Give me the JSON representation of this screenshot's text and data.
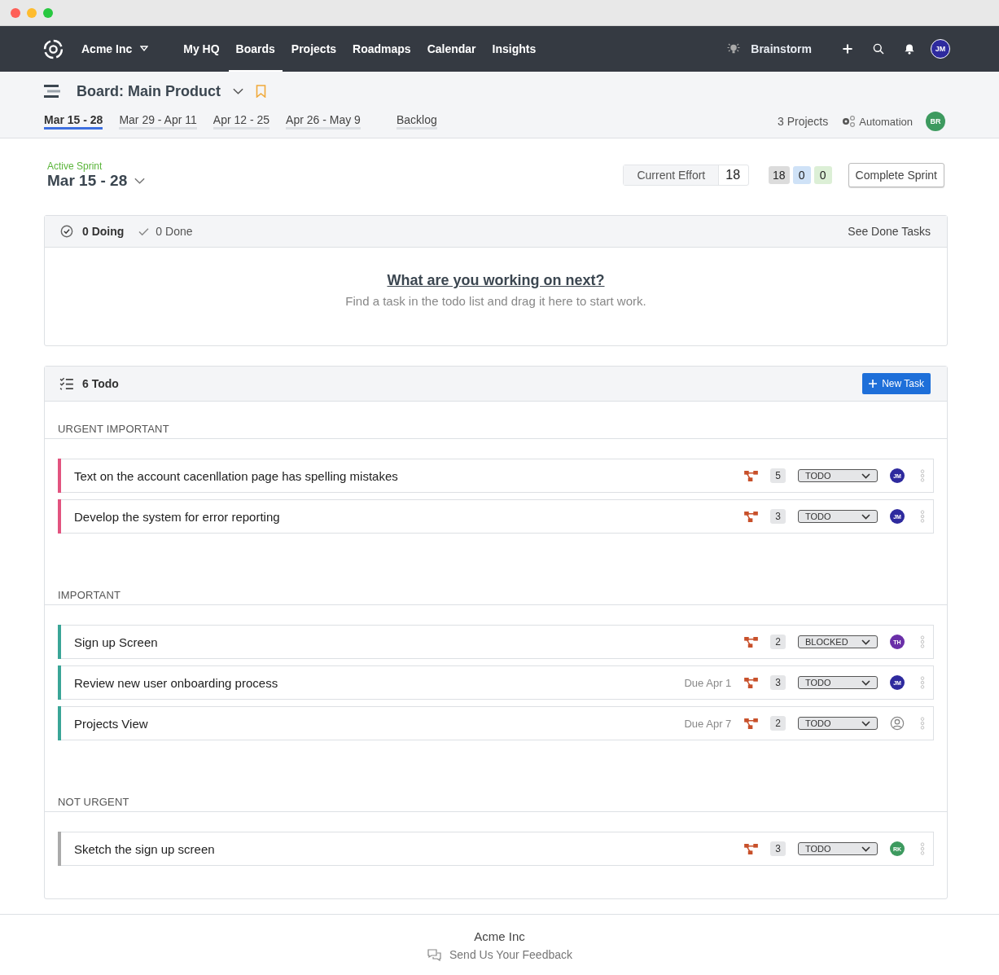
{
  "nav": {
    "org": "Acme Inc",
    "items": [
      {
        "label": "My HQ",
        "selected": false
      },
      {
        "label": "Boards",
        "selected": true
      },
      {
        "label": "Projects",
        "selected": false
      },
      {
        "label": "Roadmaps",
        "selected": false
      },
      {
        "label": "Calendar",
        "selected": false
      },
      {
        "label": "Insights",
        "selected": false
      }
    ],
    "brainstorm": "Brainstorm",
    "user": {
      "initials": "JM",
      "color": "#2e2a9e"
    }
  },
  "board": {
    "title": "Board: Main Product",
    "sprints": [
      {
        "label": "Mar 15 - 28",
        "selected": true
      },
      {
        "label": "Mar 29 - Apr 11",
        "selected": false
      },
      {
        "label": "Apr 12 - 25",
        "selected": false
      },
      {
        "label": "Apr 26 - May 9",
        "selected": false
      },
      {
        "label": "Backlog",
        "selected": false
      }
    ],
    "projects": "3 Projects",
    "automation": "Automation",
    "member": {
      "initials": "BR",
      "color": "#3d9a5f"
    }
  },
  "sprint": {
    "status": "Active Sprint",
    "range": "Mar 15 - 28",
    "effort_label": "Current Effort",
    "effort": "18",
    "counts": [
      {
        "value": "18",
        "color": "#dcdcdc"
      },
      {
        "value": "0",
        "color": "#cfe2f7"
      },
      {
        "value": "0",
        "color": "#dcefd6"
      }
    ],
    "complete": "Complete Sprint"
  },
  "doing": {
    "doing": "0 Doing",
    "done": "0 Done",
    "see_done": "See Done Tasks",
    "empty_title": "What are you working on next?",
    "empty_text": "Find a task in the todo list and drag it here to start work."
  },
  "todo": {
    "title": "6 Todo",
    "new_task": "New Task",
    "groups": [
      {
        "name": "URGENT IMPORTANT",
        "color": "#e2537f",
        "tasks": [
          {
            "title": "Text on the account cacenllation page has spelling mistakes",
            "effort": "5",
            "status": "TODO",
            "assignee": {
              "initials": "JM",
              "color": "#2e2a9e"
            }
          },
          {
            "title": "Develop the system for error reporting",
            "effort": "3",
            "status": "TODO",
            "assignee": {
              "initials": "JM",
              "color": "#2e2a9e"
            }
          }
        ]
      },
      {
        "name": "IMPORTANT",
        "color": "#3aa597",
        "tasks": [
          {
            "title": "Sign up Screen",
            "effort": "2",
            "status": "BLOCKED",
            "assignee": {
              "initials": "TH",
              "color": "#6a2fa8"
            }
          },
          {
            "title": "Review new user onboarding process",
            "due": "Due Apr 1",
            "effort": "3",
            "status": "TODO",
            "assignee": {
              "initials": "JM",
              "color": "#2e2a9e"
            }
          },
          {
            "title": "Projects View",
            "due": "Due Apr 7",
            "effort": "2",
            "status": "TODO"
          }
        ]
      },
      {
        "name": "NOT URGENT",
        "color": "#aaaaaa",
        "tasks": [
          {
            "title": "Sketch the sign up screen",
            "effort": "3",
            "status": "TODO",
            "assignee": {
              "initials": "RK",
              "color": "#3d9a5f"
            }
          }
        ]
      }
    ]
  },
  "footer": {
    "company": "Acme Inc",
    "feedback": "Send Us Your Feedback"
  }
}
